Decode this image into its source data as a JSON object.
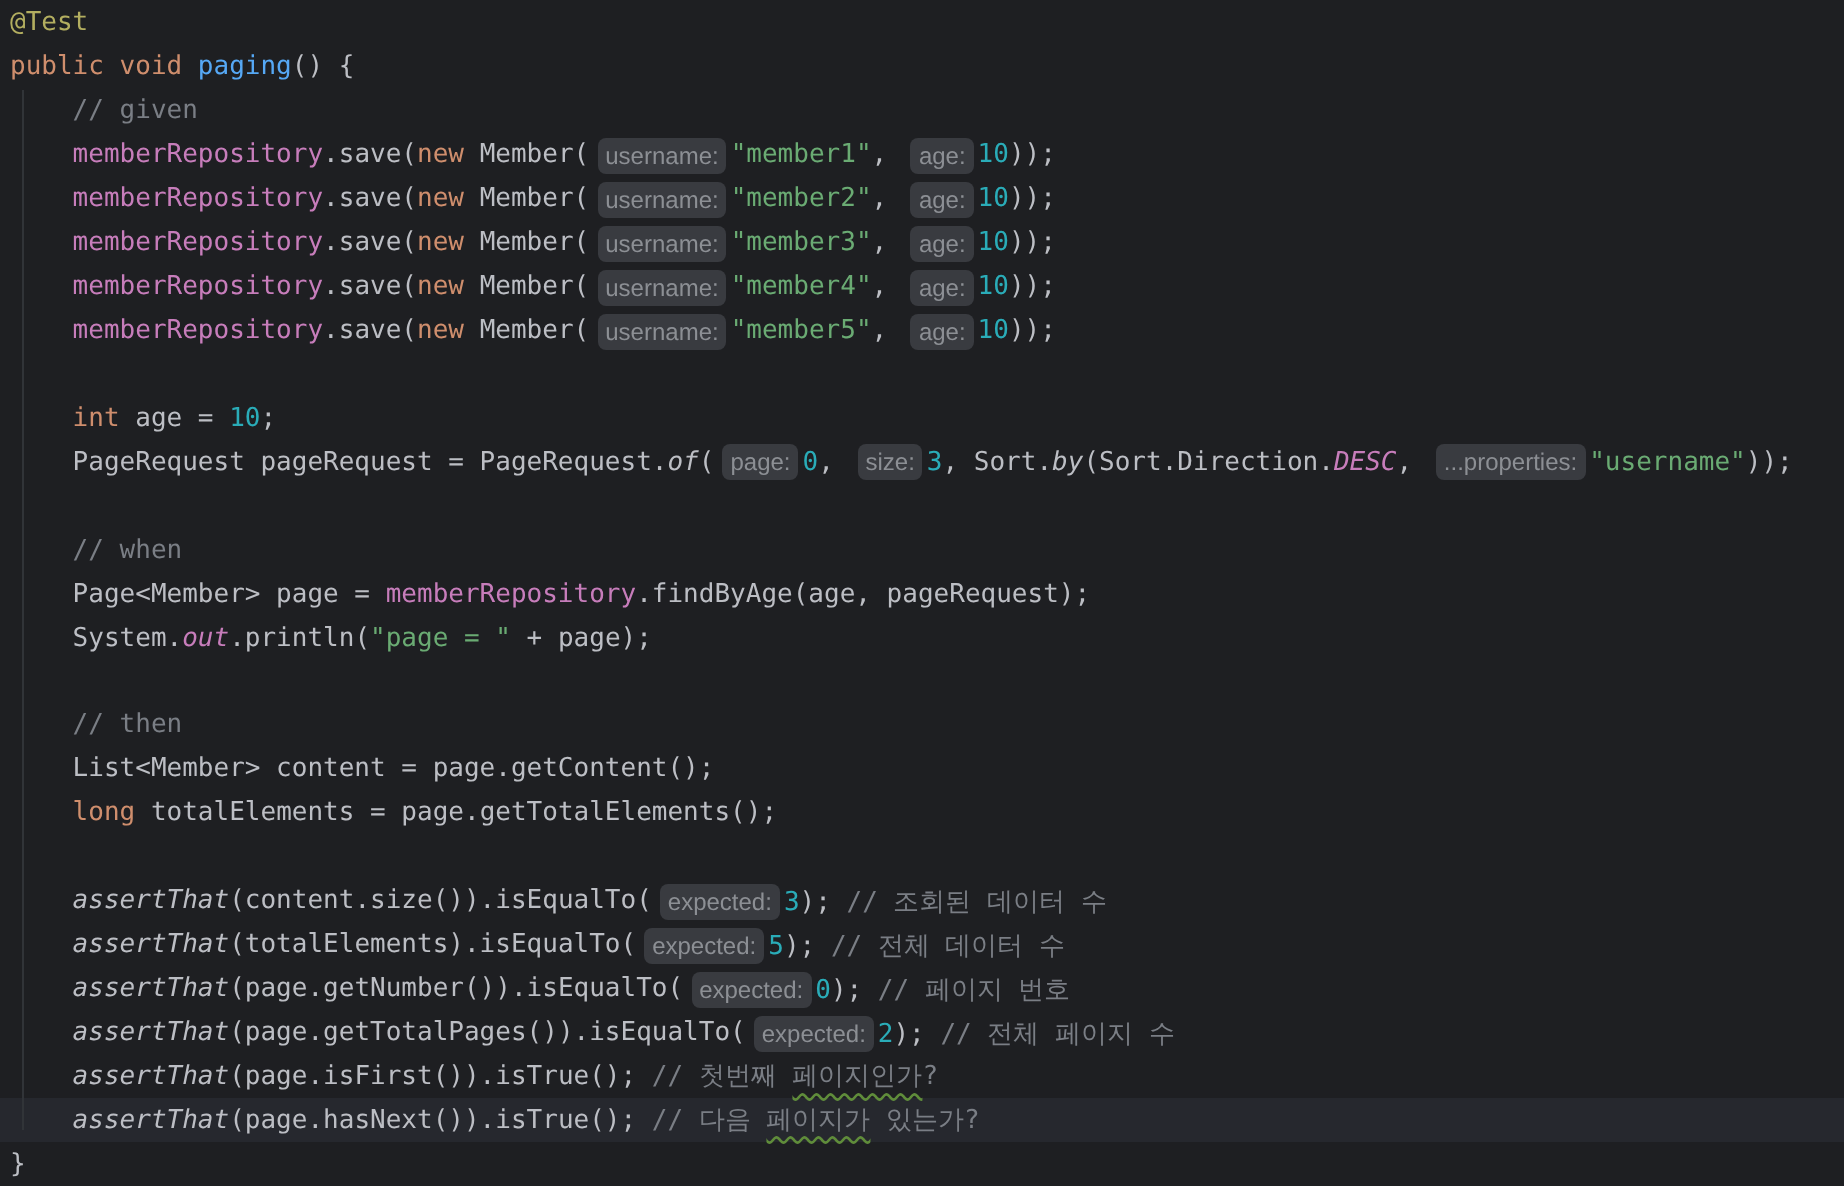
{
  "editor": {
    "lines": [
      {
        "highlighted": false,
        "tokens": [
          {
            "kind": "annotation",
            "text": "@Test"
          }
        ]
      },
      {
        "highlighted": false,
        "tokens": [
          {
            "kind": "keyword",
            "text": "public void "
          },
          {
            "kind": "method",
            "text": "paging"
          },
          {
            "kind": "plain",
            "text": "() {"
          }
        ]
      },
      {
        "highlighted": false,
        "tokens": [
          {
            "kind": "comment",
            "text": "    // given"
          }
        ]
      },
      {
        "highlighted": false,
        "tokens": [
          {
            "kind": "field",
            "text": "    memberRepository"
          },
          {
            "kind": "plain",
            "text": ".save("
          },
          {
            "kind": "keyword",
            "text": "new "
          },
          {
            "kind": "plain",
            "text": "Member("
          },
          {
            "kind": "hint",
            "text": "username:"
          },
          {
            "kind": "string",
            "text": "\"member1\""
          },
          {
            "kind": "plain",
            "text": ", "
          },
          {
            "kind": "hint",
            "text": "age:"
          },
          {
            "kind": "number",
            "text": "10"
          },
          {
            "kind": "plain",
            "text": "));"
          }
        ]
      },
      {
        "highlighted": false,
        "tokens": [
          {
            "kind": "field",
            "text": "    memberRepository"
          },
          {
            "kind": "plain",
            "text": ".save("
          },
          {
            "kind": "keyword",
            "text": "new "
          },
          {
            "kind": "plain",
            "text": "Member("
          },
          {
            "kind": "hint",
            "text": "username:"
          },
          {
            "kind": "string",
            "text": "\"member2\""
          },
          {
            "kind": "plain",
            "text": ", "
          },
          {
            "kind": "hint",
            "text": "age:"
          },
          {
            "kind": "number",
            "text": "10"
          },
          {
            "kind": "plain",
            "text": "));"
          }
        ]
      },
      {
        "highlighted": false,
        "tokens": [
          {
            "kind": "field",
            "text": "    memberRepository"
          },
          {
            "kind": "plain",
            "text": ".save("
          },
          {
            "kind": "keyword",
            "text": "new "
          },
          {
            "kind": "plain",
            "text": "Member("
          },
          {
            "kind": "hint",
            "text": "username:"
          },
          {
            "kind": "string",
            "text": "\"member3\""
          },
          {
            "kind": "plain",
            "text": ", "
          },
          {
            "kind": "hint",
            "text": "age:"
          },
          {
            "kind": "number",
            "text": "10"
          },
          {
            "kind": "plain",
            "text": "));"
          }
        ]
      },
      {
        "highlighted": false,
        "tokens": [
          {
            "kind": "field",
            "text": "    memberRepository"
          },
          {
            "kind": "plain",
            "text": ".save("
          },
          {
            "kind": "keyword",
            "text": "new "
          },
          {
            "kind": "plain",
            "text": "Member("
          },
          {
            "kind": "hint",
            "text": "username:"
          },
          {
            "kind": "string",
            "text": "\"member4\""
          },
          {
            "kind": "plain",
            "text": ", "
          },
          {
            "kind": "hint",
            "text": "age:"
          },
          {
            "kind": "number",
            "text": "10"
          },
          {
            "kind": "plain",
            "text": "));"
          }
        ]
      },
      {
        "highlighted": false,
        "tokens": [
          {
            "kind": "field",
            "text": "    memberRepository"
          },
          {
            "kind": "plain",
            "text": ".save("
          },
          {
            "kind": "keyword",
            "text": "new "
          },
          {
            "kind": "plain",
            "text": "Member("
          },
          {
            "kind": "hint",
            "text": "username:"
          },
          {
            "kind": "string",
            "text": "\"member5\""
          },
          {
            "kind": "plain",
            "text": ", "
          },
          {
            "kind": "hint",
            "text": "age:"
          },
          {
            "kind": "number",
            "text": "10"
          },
          {
            "kind": "plain",
            "text": "));"
          }
        ]
      },
      {
        "highlighted": false
      },
      {
        "highlighted": false,
        "tokens": [
          {
            "kind": "keyword",
            "text": "    int "
          },
          {
            "kind": "plain",
            "text": "age = "
          },
          {
            "kind": "number",
            "text": "10"
          },
          {
            "kind": "plain",
            "text": ";"
          }
        ]
      },
      {
        "highlighted": false,
        "tokens": [
          {
            "kind": "plain",
            "text": "    PageRequest pageRequest = PageRequest."
          },
          {
            "kind": "static",
            "text": "of"
          },
          {
            "kind": "plain",
            "text": "("
          },
          {
            "kind": "hint",
            "text": "page:"
          },
          {
            "kind": "number",
            "text": "0"
          },
          {
            "kind": "plain",
            "text": ", "
          },
          {
            "kind": "hint",
            "text": "size:"
          },
          {
            "kind": "number",
            "text": "3"
          },
          {
            "kind": "plain",
            "text": ", Sort."
          },
          {
            "kind": "static",
            "text": "by"
          },
          {
            "kind": "plain",
            "text": "(Sort.Direction."
          },
          {
            "kind": "constant",
            "text": "DESC"
          },
          {
            "kind": "plain",
            "text": ", "
          },
          {
            "kind": "hint",
            "text": "...properties:"
          },
          {
            "kind": "string",
            "text": "\"username\""
          },
          {
            "kind": "plain",
            "text": "));"
          }
        ]
      },
      {
        "highlighted": false
      },
      {
        "highlighted": false,
        "tokens": [
          {
            "kind": "comment",
            "text": "    // when"
          }
        ]
      },
      {
        "highlighted": false,
        "tokens": [
          {
            "kind": "plain",
            "text": "    Page<Member> page = "
          },
          {
            "kind": "field",
            "text": "memberRepository"
          },
          {
            "kind": "plain",
            "text": ".findByAge(age, pageRequest);"
          }
        ]
      },
      {
        "highlighted": false,
        "tokens": [
          {
            "kind": "plain",
            "text": "    System."
          },
          {
            "kind": "constant",
            "text": "out"
          },
          {
            "kind": "plain",
            "text": ".println("
          },
          {
            "kind": "string",
            "text": "\"page = \""
          },
          {
            "kind": "plain",
            "text": " + page);"
          }
        ]
      },
      {
        "highlighted": false
      },
      {
        "highlighted": false,
        "tokens": [
          {
            "kind": "comment",
            "text": "    // then"
          }
        ]
      },
      {
        "highlighted": false,
        "tokens": [
          {
            "kind": "plain",
            "text": "    List<Member> content = page.getContent();"
          }
        ]
      },
      {
        "highlighted": false,
        "tokens": [
          {
            "kind": "keyword",
            "text": "    long "
          },
          {
            "kind": "plain",
            "text": "totalElements = page.getTotalElements();"
          }
        ]
      },
      {
        "highlighted": false
      },
      {
        "highlighted": false,
        "tokens": [
          {
            "kind": "static",
            "text": "    assertThat"
          },
          {
            "kind": "plain",
            "text": "(content.size()).isEqualTo("
          },
          {
            "kind": "hint",
            "text": "expected:"
          },
          {
            "kind": "number",
            "text": "3"
          },
          {
            "kind": "plain",
            "text": "); "
          },
          {
            "kind": "comment",
            "text": "// 조회된 데이터 수"
          }
        ]
      },
      {
        "highlighted": false,
        "tokens": [
          {
            "kind": "static",
            "text": "    assertThat"
          },
          {
            "kind": "plain",
            "text": "(totalElements).isEqualTo("
          },
          {
            "kind": "hint",
            "text": "expected:"
          },
          {
            "kind": "number",
            "text": "5"
          },
          {
            "kind": "plain",
            "text": "); "
          },
          {
            "kind": "comment",
            "text": "// 전체 데이터 수"
          }
        ]
      },
      {
        "highlighted": false,
        "tokens": [
          {
            "kind": "static",
            "text": "    assertThat"
          },
          {
            "kind": "plain",
            "text": "(page.getNumber()).isEqualTo("
          },
          {
            "kind": "hint",
            "text": "expected:"
          },
          {
            "kind": "number",
            "text": "0"
          },
          {
            "kind": "plain",
            "text": "); "
          },
          {
            "kind": "comment",
            "text": "// 페이지 번호"
          }
        ]
      },
      {
        "highlighted": false,
        "tokens": [
          {
            "kind": "static",
            "text": "    assertThat"
          },
          {
            "kind": "plain",
            "text": "(page.getTotalPages()).isEqualTo("
          },
          {
            "kind": "hint",
            "text": "expected:"
          },
          {
            "kind": "number",
            "text": "2"
          },
          {
            "kind": "plain",
            "text": "); "
          },
          {
            "kind": "comment",
            "text": "// 전체 페이지 수"
          }
        ]
      },
      {
        "highlighted": false,
        "tokens": [
          {
            "kind": "static",
            "text": "    assertThat"
          },
          {
            "kind": "plain",
            "text": "(page.isFirst()).isTrue(); "
          },
          {
            "kind": "comment",
            "text": "// 첫번째 "
          },
          {
            "kind": "typo",
            "text": "페이지인가"
          },
          {
            "kind": "comment",
            "text": "?"
          }
        ]
      },
      {
        "highlighted": true,
        "tokens": [
          {
            "kind": "static",
            "text": "    assertThat"
          },
          {
            "kind": "plain",
            "text": "(page.hasNext()).isTrue(); "
          },
          {
            "kind": "comment",
            "text": "// 다음 "
          },
          {
            "kind": "typo",
            "text": "페이지가"
          },
          {
            "kind": "comment",
            "text": " 있는가?"
          }
        ]
      },
      {
        "highlighted": false,
        "tokens": [
          {
            "kind": "plain",
            "text": "}"
          }
        ]
      }
    ]
  }
}
